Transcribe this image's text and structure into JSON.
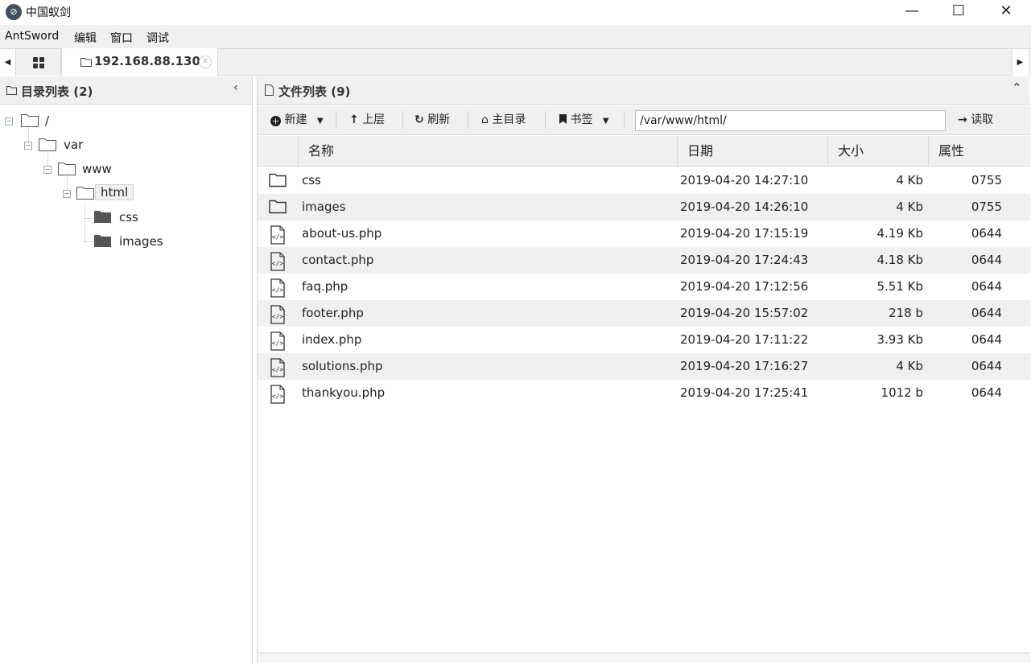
{
  "window": {
    "title": "中国蚁剑",
    "minimize": "—",
    "maximize": "☐",
    "close": "✕"
  },
  "menu": {
    "items": [
      "AntSword",
      "编辑",
      "窗口",
      "调试"
    ]
  },
  "tabs": {
    "active_label": "192.168.88.130",
    "close_glyph": "✕"
  },
  "left_panel": {
    "title": "目录列表 (2)",
    "tree": [
      {
        "label": "/",
        "depth": 0
      },
      {
        "label": "var",
        "depth": 1
      },
      {
        "label": "www",
        "depth": 2
      },
      {
        "label": "html",
        "depth": 3,
        "selected": true
      },
      {
        "label": "css",
        "depth": 4
      },
      {
        "label": "images",
        "depth": 4
      }
    ]
  },
  "right_panel": {
    "title": "文件列表 (9)",
    "toolbar": {
      "new_label": "新建",
      "up_label": "上层",
      "refresh_label": "刷新",
      "home_label": "主目录",
      "bookmark_label": "书签",
      "path_value": "/var/www/html/",
      "read_label": "读取"
    },
    "columns": {
      "name": "名称",
      "date": "日期",
      "size": "大小",
      "attr": "属性"
    },
    "files": [
      {
        "type": "folder",
        "name": "css",
        "date": "2019-04-20 14:27:10",
        "size": "4 Kb",
        "attr": "0755"
      },
      {
        "type": "folder",
        "name": "images",
        "date": "2019-04-20 14:26:10",
        "size": "4 Kb",
        "attr": "0755"
      },
      {
        "type": "file",
        "name": "about-us.php",
        "date": "2019-04-20 17:15:19",
        "size": "4.19 Kb",
        "attr": "0644"
      },
      {
        "type": "file",
        "name": "contact.php",
        "date": "2019-04-20 17:24:43",
        "size": "4.18 Kb",
        "attr": "0644"
      },
      {
        "type": "file",
        "name": "faq.php",
        "date": "2019-04-20 17:12:56",
        "size": "5.51 Kb",
        "attr": "0644"
      },
      {
        "type": "file",
        "name": "footer.php",
        "date": "2019-04-20 15:57:02",
        "size": "218 b",
        "attr": "0644"
      },
      {
        "type": "file",
        "name": "index.php",
        "date": "2019-04-20 17:11:22",
        "size": "3.93 Kb",
        "attr": "0644"
      },
      {
        "type": "file",
        "name": "solutions.php",
        "date": "2019-04-20 17:16:27",
        "size": "4 Kb",
        "attr": "0644"
      },
      {
        "type": "file",
        "name": "thankyou.php",
        "date": "2019-04-20 17:25:41",
        "size": "1012 b",
        "attr": "0644"
      }
    ]
  }
}
